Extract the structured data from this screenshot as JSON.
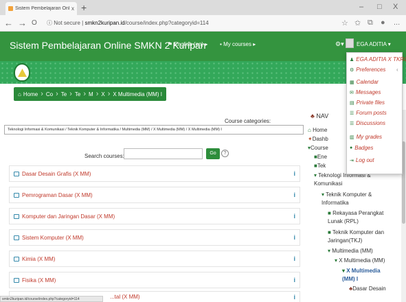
{
  "browser": {
    "tab_title": "Sistem Pembelajaran Online SM",
    "tab_close": "x",
    "new_tab": "+",
    "win_min": "–",
    "win_max": "□",
    "win_close": "X",
    "back": "←",
    "forward": "→",
    "reload": "O",
    "security": "Not secure",
    "url_host": "smkn2kuripan.id",
    "url_path": "/course/index.php?categoryid=114",
    "star": "☆",
    "more": "..."
  },
  "header": {
    "site_title": "Sistem Pembelajaran Online SMKN 2 Kuripan",
    "language": "English (en)",
    "my_courses": "My courses",
    "user_name": "EGA ADITIA"
  },
  "breadcrumb": [
    "Home",
    "Co",
    "Te",
    "Te",
    "M",
    "X",
    "X Multimedia (MM) I"
  ],
  "main": {
    "course_categories_label": "Course categories:",
    "category_value": "Teknologi Informasi & Komunikasi / Teknik Komputer & Informatika / Multimedia (MM) / X Multimedia (MM) / X Multimedia (MM) I",
    "search_label": "Search courses:",
    "search_button": "Go",
    "help": "?",
    "courses": [
      "Dasar Desain Grafis (X MM)",
      "Pemrograman Dasar (X MM)",
      "Komputer dan Jaringan Dasar (X MM)",
      "Sistem Komputer (X MM)",
      "Kimia (X MM)",
      "Fisika (X MM)",
      "...tal (X MM)"
    ],
    "info_glyph": "i"
  },
  "nav": {
    "heading": "NAV",
    "items": [
      "Home",
      "Dashb",
      "Course",
      "Ene",
      "Tek",
      "Teknologi Informasi &",
      "Komunikasi",
      "Teknik Komputer &",
      "Informatika",
      "Rekayasa Perangkat",
      "Lunak (RPL)",
      "Teknik Komputer dan",
      "Jaringan(TKJ)",
      "Multimedia (MM)",
      "X Multimedia (MM)",
      "X Multimedia",
      "(MM) I",
      "Dasar Desain"
    ]
  },
  "user_menu": {
    "items": [
      "EGA ADITIA X TKRO",
      "Preferences",
      "Calendar",
      "Messages",
      "Private files",
      "Forum posts",
      "Discussions",
      "My grades",
      "Badges",
      "Log out"
    ]
  },
  "status_url": "smkn2kuripan.id/course/index.php?categoryid=114"
}
